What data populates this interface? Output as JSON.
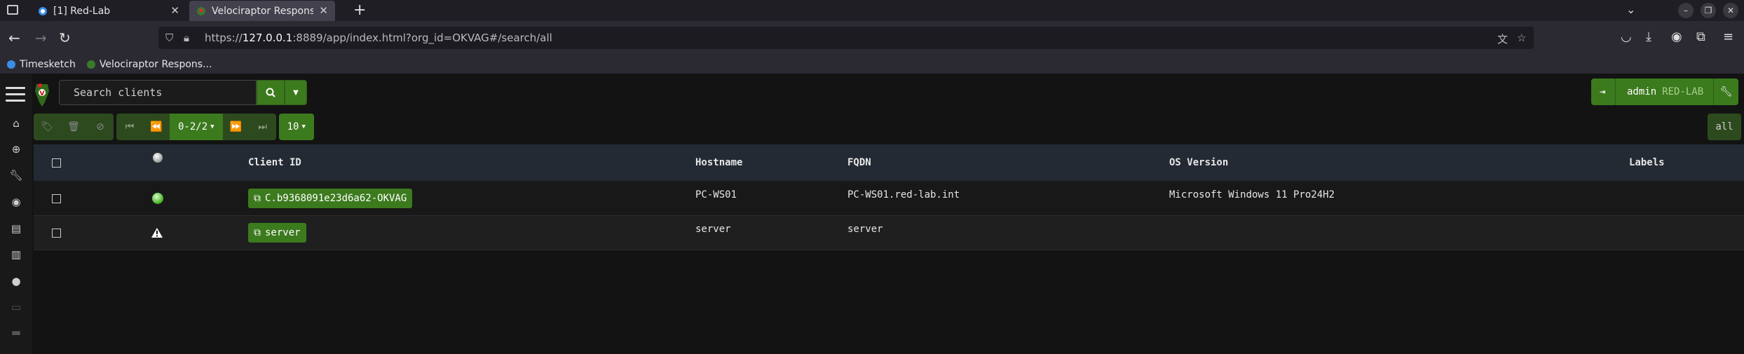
{
  "browser": {
    "tabs": [
      {
        "title": "[1] Red-Lab",
        "active": false
      },
      {
        "title": "Velociraptor Response an",
        "active": true
      }
    ],
    "url": {
      "prefix": "https://",
      "host": "127.0.0.1",
      "rest": ":8889/app/index.html?org_id=OKVAG#/search/all"
    },
    "bookmarks": [
      {
        "label": "Timesketch"
      },
      {
        "label": "Velociraptor Respons..."
      }
    ]
  },
  "app": {
    "search": {
      "placeholder": "Search clients"
    },
    "user": {
      "name": "admin",
      "org": "RED-LAB"
    },
    "pager": {
      "range": "0-2/2",
      "page_size": "10"
    },
    "filter": {
      "label": "all"
    },
    "table": {
      "headers": {
        "client_id": "Client ID",
        "hostname": "Hostname",
        "fqdn": "FQDN",
        "os_version": "OS Version",
        "labels": "Labels"
      },
      "rows": [
        {
          "status": "online",
          "client_id": "C.b9368091e23d6a62-OKVAG",
          "hostname": "PC-WS01",
          "fqdn": "PC-WS01.red-lab.int",
          "os_version": "Microsoft Windows 11 Pro24H2",
          "labels": ""
        },
        {
          "status": "warning",
          "client_id": "server",
          "hostname": "server",
          "fqdn": "server",
          "os_version": "",
          "labels": ""
        }
      ]
    },
    "colors": {
      "accent": "#3c7a1e",
      "header_bg": "#232a33",
      "background": "#131313"
    }
  }
}
